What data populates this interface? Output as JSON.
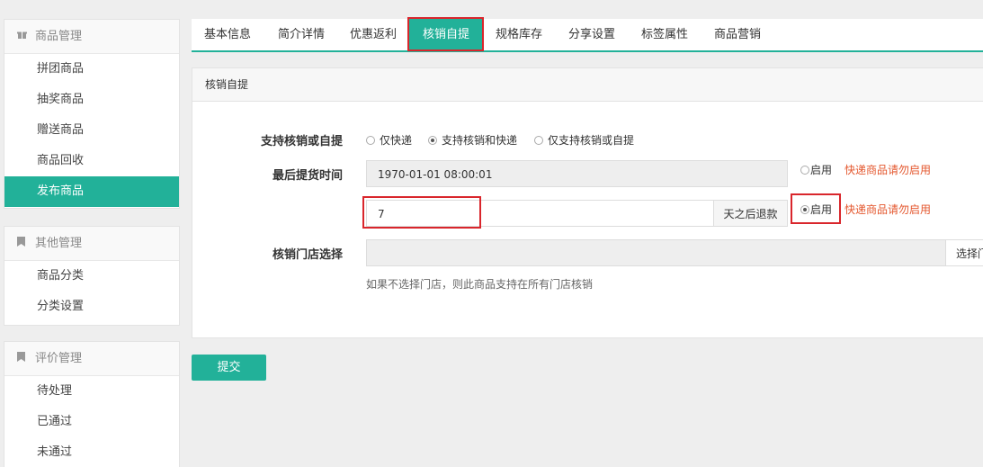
{
  "sidebar": {
    "groups": [
      {
        "title": "商品管理",
        "icon": "gift-icon",
        "items": [
          "拼团商品",
          "抽奖商品",
          "赠送商品",
          "商品回收",
          "发布商品"
        ],
        "active": "发布商品"
      },
      {
        "title": "其他管理",
        "icon": "bookmark-icon",
        "items": [
          "商品分类",
          "分类设置"
        ]
      },
      {
        "title": "评价管理",
        "icon": "bookmark-icon",
        "items": [
          "待处理",
          "已通过",
          "未通过"
        ]
      }
    ]
  },
  "tabs": [
    "基本信息",
    "简介详情",
    "优惠返利",
    "核销自提",
    "规格库存",
    "分享设置",
    "标签属性",
    "商品营销"
  ],
  "active_tab": "核销自提",
  "panel": {
    "title": "核销自提",
    "support_label": "支持核销或自提",
    "support_options": [
      "仅快递",
      "支持核销和快递",
      "仅支持核销或自提"
    ],
    "support_selected": "支持核销和快递",
    "last_pickup_label": "最后提货时间",
    "last_pickup_value": "1970-01-01 08:00:01",
    "enable_label": "启用",
    "warn_text": "快递商品请勿启用",
    "refund_days_value": "7",
    "refund_suffix": "天之后退款",
    "enable_label_2": "启用",
    "warn_text_2": "快递商品请勿启用",
    "store_label": "核销门店选择",
    "store_button": "选择门",
    "store_hint": "如果不选择门店，则此商品支持在所有门店核销"
  },
  "submit_label": "提交",
  "colors": {
    "accent": "#22b199",
    "warn": "#e4572e",
    "highlight": "#d9262c"
  }
}
